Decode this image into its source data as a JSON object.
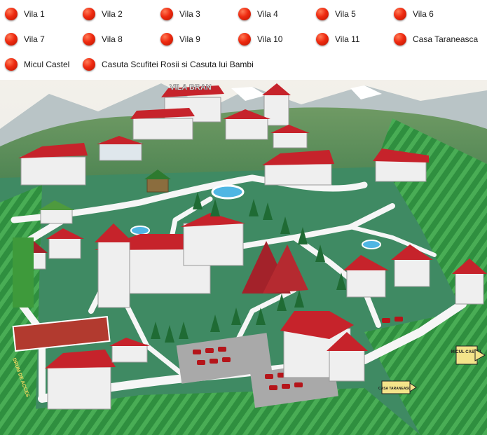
{
  "legend": {
    "items": [
      {
        "label": "Vila 1"
      },
      {
        "label": "Vila 2"
      },
      {
        "label": "Vila 3"
      },
      {
        "label": "Vila 4"
      },
      {
        "label": "Vila 5"
      },
      {
        "label": "Vila 6"
      },
      {
        "label": "Vila 7"
      },
      {
        "label": "Vila 8"
      },
      {
        "label": "Vila 9"
      },
      {
        "label": "Vila 10"
      },
      {
        "label": "Vila 11"
      },
      {
        "label": "Casa Taraneasca"
      },
      {
        "label": "Micul Castel"
      },
      {
        "label": "Casuta Scufitei Rosii si Casuta lui Bambi"
      }
    ],
    "dot_color": "#e8280f"
  },
  "map": {
    "main_building_sign": "VILA BRAN",
    "road_sign_access": "DRUM DE ACCES",
    "sign_micul_castel": "MICUL CASTEL",
    "sign_casa_taraneasca": "CASA TARANEASCA"
  }
}
